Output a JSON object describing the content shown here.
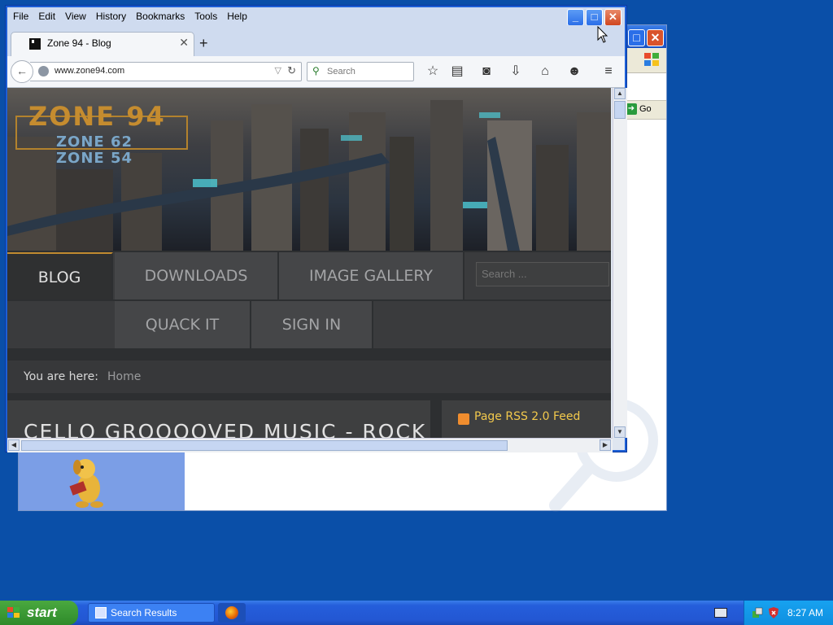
{
  "firefox": {
    "menu": [
      "File",
      "Edit",
      "View",
      "History",
      "Bookmarks",
      "Tools",
      "Help"
    ],
    "tab_title": "Zone 94 - Blog",
    "url": "www.zone94.com",
    "search_placeholder": "Search",
    "window_buttons": {
      "minimize": "_",
      "maximize": "□",
      "close": "✕"
    }
  },
  "site": {
    "logo": {
      "main": "ZONE 94",
      "sub1": "ZONE 62",
      "sub2": "ZONE 54"
    },
    "nav": [
      "BLOG",
      "DOWNLOADS",
      "IMAGE GALLERY",
      "QUACK IT",
      "SIGN IN"
    ],
    "search_placeholder": "Search ...",
    "breadcrumb_label": "You are here:",
    "breadcrumb_home": "Home",
    "article_title_fragment": "CELLO GROOOOVED MUSIC - ROCK",
    "rss_label": "Page RSS 2.0 Feed"
  },
  "background_window": {
    "go_label": "Go"
  },
  "taskbar": {
    "start_label": "start",
    "tasks": [
      "Search Results"
    ],
    "clock": "8:27 AM"
  },
  "colors": {
    "accent": "#c08a30",
    "rss": "#f2c94c",
    "xp_blue": "#245edb"
  }
}
